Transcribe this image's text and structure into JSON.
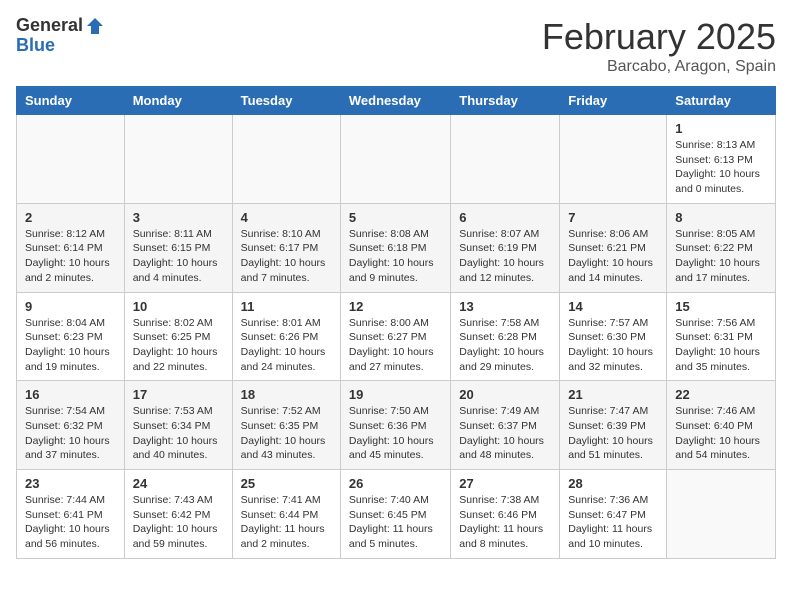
{
  "header": {
    "logo_general": "General",
    "logo_blue": "Blue",
    "month_title": "February 2025",
    "location": "Barcabo, Aragon, Spain"
  },
  "days_of_week": [
    "Sunday",
    "Monday",
    "Tuesday",
    "Wednesday",
    "Thursday",
    "Friday",
    "Saturday"
  ],
  "weeks": [
    [
      {
        "day": "",
        "info": ""
      },
      {
        "day": "",
        "info": ""
      },
      {
        "day": "",
        "info": ""
      },
      {
        "day": "",
        "info": ""
      },
      {
        "day": "",
        "info": ""
      },
      {
        "day": "",
        "info": ""
      },
      {
        "day": "1",
        "info": "Sunrise: 8:13 AM\nSunset: 6:13 PM\nDaylight: 10 hours\nand 0 minutes."
      }
    ],
    [
      {
        "day": "2",
        "info": "Sunrise: 8:12 AM\nSunset: 6:14 PM\nDaylight: 10 hours\nand 2 minutes."
      },
      {
        "day": "3",
        "info": "Sunrise: 8:11 AM\nSunset: 6:15 PM\nDaylight: 10 hours\nand 4 minutes."
      },
      {
        "day": "4",
        "info": "Sunrise: 8:10 AM\nSunset: 6:17 PM\nDaylight: 10 hours\nand 7 minutes."
      },
      {
        "day": "5",
        "info": "Sunrise: 8:08 AM\nSunset: 6:18 PM\nDaylight: 10 hours\nand 9 minutes."
      },
      {
        "day": "6",
        "info": "Sunrise: 8:07 AM\nSunset: 6:19 PM\nDaylight: 10 hours\nand 12 minutes."
      },
      {
        "day": "7",
        "info": "Sunrise: 8:06 AM\nSunset: 6:21 PM\nDaylight: 10 hours\nand 14 minutes."
      },
      {
        "day": "8",
        "info": "Sunrise: 8:05 AM\nSunset: 6:22 PM\nDaylight: 10 hours\nand 17 minutes."
      }
    ],
    [
      {
        "day": "9",
        "info": "Sunrise: 8:04 AM\nSunset: 6:23 PM\nDaylight: 10 hours\nand 19 minutes."
      },
      {
        "day": "10",
        "info": "Sunrise: 8:02 AM\nSunset: 6:25 PM\nDaylight: 10 hours\nand 22 minutes."
      },
      {
        "day": "11",
        "info": "Sunrise: 8:01 AM\nSunset: 6:26 PM\nDaylight: 10 hours\nand 24 minutes."
      },
      {
        "day": "12",
        "info": "Sunrise: 8:00 AM\nSunset: 6:27 PM\nDaylight: 10 hours\nand 27 minutes."
      },
      {
        "day": "13",
        "info": "Sunrise: 7:58 AM\nSunset: 6:28 PM\nDaylight: 10 hours\nand 29 minutes."
      },
      {
        "day": "14",
        "info": "Sunrise: 7:57 AM\nSunset: 6:30 PM\nDaylight: 10 hours\nand 32 minutes."
      },
      {
        "day": "15",
        "info": "Sunrise: 7:56 AM\nSunset: 6:31 PM\nDaylight: 10 hours\nand 35 minutes."
      }
    ],
    [
      {
        "day": "16",
        "info": "Sunrise: 7:54 AM\nSunset: 6:32 PM\nDaylight: 10 hours\nand 37 minutes."
      },
      {
        "day": "17",
        "info": "Sunrise: 7:53 AM\nSunset: 6:34 PM\nDaylight: 10 hours\nand 40 minutes."
      },
      {
        "day": "18",
        "info": "Sunrise: 7:52 AM\nSunset: 6:35 PM\nDaylight: 10 hours\nand 43 minutes."
      },
      {
        "day": "19",
        "info": "Sunrise: 7:50 AM\nSunset: 6:36 PM\nDaylight: 10 hours\nand 45 minutes."
      },
      {
        "day": "20",
        "info": "Sunrise: 7:49 AM\nSunset: 6:37 PM\nDaylight: 10 hours\nand 48 minutes."
      },
      {
        "day": "21",
        "info": "Sunrise: 7:47 AM\nSunset: 6:39 PM\nDaylight: 10 hours\nand 51 minutes."
      },
      {
        "day": "22",
        "info": "Sunrise: 7:46 AM\nSunset: 6:40 PM\nDaylight: 10 hours\nand 54 minutes."
      }
    ],
    [
      {
        "day": "23",
        "info": "Sunrise: 7:44 AM\nSunset: 6:41 PM\nDaylight: 10 hours\nand 56 minutes."
      },
      {
        "day": "24",
        "info": "Sunrise: 7:43 AM\nSunset: 6:42 PM\nDaylight: 10 hours\nand 59 minutes."
      },
      {
        "day": "25",
        "info": "Sunrise: 7:41 AM\nSunset: 6:44 PM\nDaylight: 11 hours\nand 2 minutes."
      },
      {
        "day": "26",
        "info": "Sunrise: 7:40 AM\nSunset: 6:45 PM\nDaylight: 11 hours\nand 5 minutes."
      },
      {
        "day": "27",
        "info": "Sunrise: 7:38 AM\nSunset: 6:46 PM\nDaylight: 11 hours\nand 8 minutes."
      },
      {
        "day": "28",
        "info": "Sunrise: 7:36 AM\nSunset: 6:47 PM\nDaylight: 11 hours\nand 10 minutes."
      },
      {
        "day": "",
        "info": ""
      }
    ]
  ]
}
